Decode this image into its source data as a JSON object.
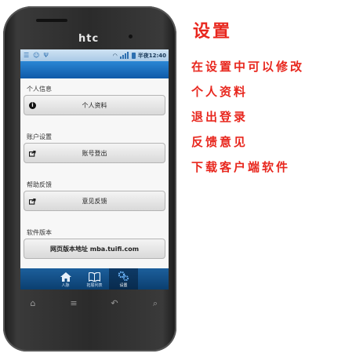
{
  "phone": {
    "brand": "htc"
  },
  "statusbar": {
    "time": "半夜12:40"
  },
  "sections": [
    {
      "label": "个人信息",
      "button": "个人资料",
      "icon": "info-icon"
    },
    {
      "label": "账户设置",
      "button": "账号登出",
      "icon": "logout-icon"
    },
    {
      "label": "帮助反馈",
      "button": "意见反馈",
      "icon": "feedback-icon"
    },
    {
      "label": "软件版本",
      "button": "网页版本地址 mba.tuifi.com",
      "icon": ""
    }
  ],
  "tabs": [
    {
      "label": "人脉",
      "icon": "home-icon"
    },
    {
      "label": "拓展列表",
      "icon": "book-icon"
    },
    {
      "label": "设置",
      "icon": "gear-icon",
      "active": true
    }
  ],
  "annotation": {
    "title": "设置",
    "items": [
      "在设置中可以修改",
      "个人资料",
      "退出登录",
      "反馈意见",
      "下载客户端软件"
    ]
  },
  "colors": {
    "accent": "#e8271e",
    "tabbar": "#0b3f70",
    "bluebar": "#1772c2"
  }
}
